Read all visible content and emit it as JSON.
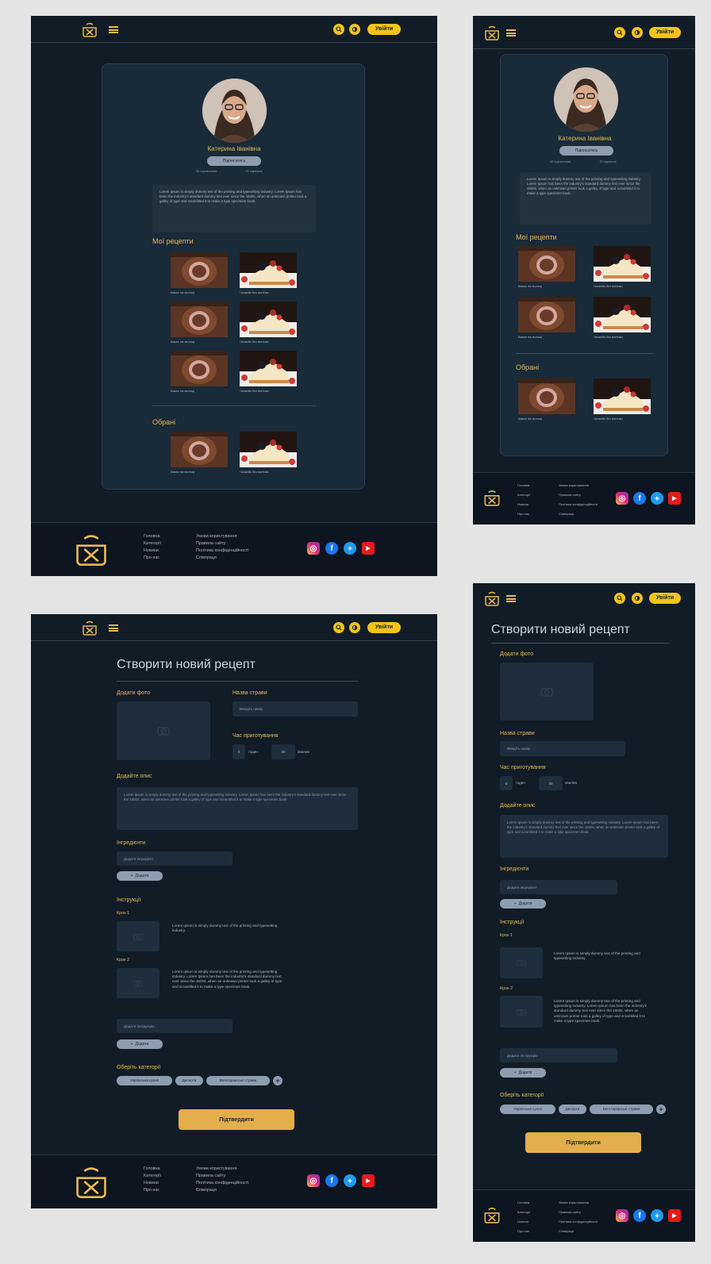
{
  "header": {
    "login_label": "Увійти",
    "search_icon": "search-icon",
    "theme_icon": "theme-toggle-icon",
    "logo_icon": "chef-pot-logo-icon",
    "menu_icon": "hamburger-menu-icon"
  },
  "profile": {
    "name": "Катерина Іванівна",
    "subscribe_label": "Підписатись",
    "followers": "30 підписників",
    "following": "70 підписок",
    "bio": "Lorem Ipsum is simply dummy text of the printing and typesetting industry. Lorem Ipsum has been the industry's standard dummy text ever since the 1500s, when an unknown printer took a galley of type and scrambled it to make a type specimen book."
  },
  "sections": {
    "my_recipes": "Мої рецепти",
    "favorites": "Обрані"
  },
  "recipes": {
    "cocoa": "Какао на молоці",
    "cheesecake": "Чизкейк без випічки"
  },
  "create_form": {
    "title": "Створити новий рецепт",
    "add_photo": "Додати фото",
    "dish_name_label": "Назва страви",
    "dish_name_placeholder": "Введіть назву",
    "cook_time_label": "Час приготування",
    "hours_value": "0",
    "hours_unit": "годин",
    "minutes_value": "30",
    "minutes_unit": "хвилин",
    "description_label": "Додайте опис",
    "description_text": "Lorem Ipsum is simply dummy text of the printing and typesetting industry. Lorem Ipsum has been the industry's standard dummy text ever since the 1500s, when an unknown printer took a galley of type and scrambled it to make a type specimen book.",
    "ingredients_label": "Інгредієнти",
    "ingredient_placeholder": "Додати інгредієнт",
    "add_label": "Додати",
    "instructions_label": "Інструкції",
    "step1_label": "Крок 1",
    "step1_text": "Lorem Ipsum is simply dummy text of the printing and typesetting industry.",
    "step2_label": "Крок 2",
    "step2_text": "Lorem Ipsum is simply dummy text of the printing and typesetting industry. Lorem Ipsum has been the industry's standard dummy text ever since the 1500s, when an unknown printer took a galley of type and scrambled it to make a type specimen book.",
    "instruction_placeholder": "Додати інструкцію",
    "category_label": "Оберіть категорії",
    "categories": [
      "Українська кухня",
      "Десерти",
      "Вегетаріанські страви"
    ],
    "submit_label": "Підтвердити"
  },
  "footer": {
    "col1": [
      "Головна",
      "Категорії",
      "Новини",
      "Про нас"
    ],
    "col2": [
      "Умови користування",
      "Правила сайту",
      "Політика конфіденційності",
      "Співпраця"
    ],
    "social": [
      "instagram-icon",
      "facebook-icon",
      "twitter-icon",
      "youtube-icon"
    ]
  },
  "colors": {
    "background": "#111c27",
    "accent": "#e7ba53",
    "button": "#f3c316",
    "card": "#192a38",
    "footer": "#0c1520"
  }
}
